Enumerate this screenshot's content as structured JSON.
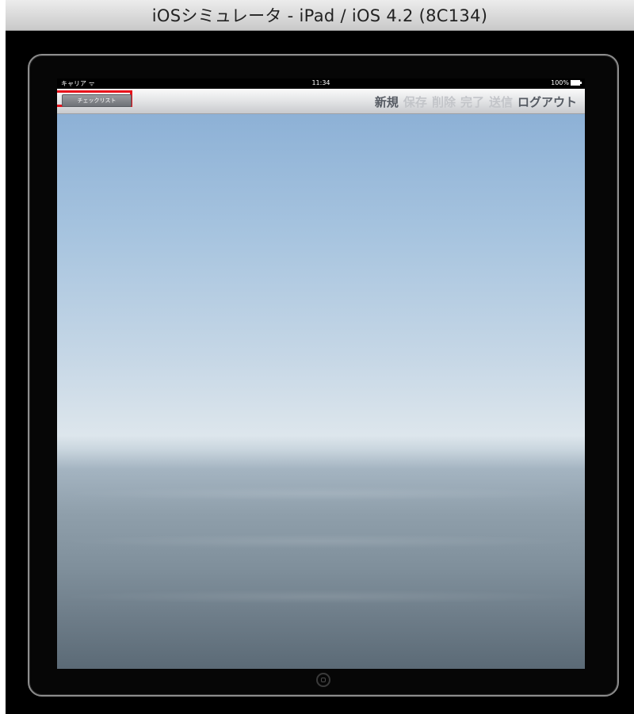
{
  "window": {
    "title": "iOSシミュレータ - iPad / iOS 4.2 (8C134)"
  },
  "status_bar": {
    "carrier": "キャリア",
    "wifi_icon": "wifi-icon",
    "time": "11:34",
    "battery": "100%"
  },
  "nav_bar": {
    "checklist_label": "チェックリスト",
    "actions": [
      {
        "label": "新規",
        "enabled": true
      },
      {
        "label": "保存",
        "enabled": false
      },
      {
        "label": "削除",
        "enabled": false
      },
      {
        "label": "完了",
        "enabled": false
      },
      {
        "label": "送信",
        "enabled": false
      },
      {
        "label": "ログアウト",
        "enabled": true
      }
    ]
  },
  "highlight_color": "#e8121b"
}
